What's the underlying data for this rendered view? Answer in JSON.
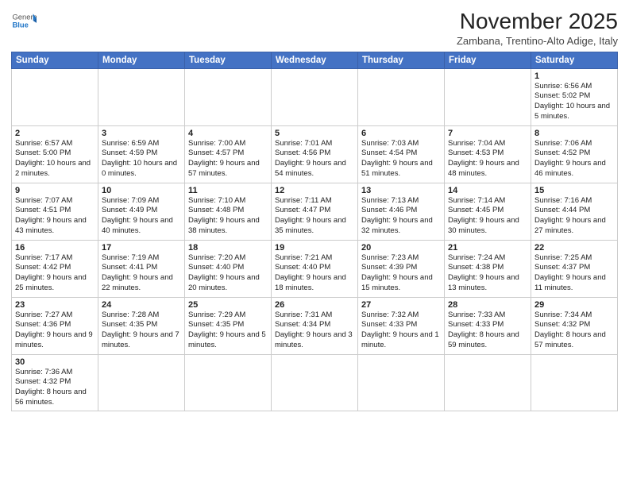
{
  "header": {
    "logo_general": "General",
    "logo_blue": "Blue",
    "title": "November 2025",
    "subtitle": "Zambana, Trentino-Alto Adige, Italy"
  },
  "days": [
    "Sunday",
    "Monday",
    "Tuesday",
    "Wednesday",
    "Thursday",
    "Friday",
    "Saturday"
  ],
  "weeks": [
    [
      {
        "date": "",
        "info": ""
      },
      {
        "date": "",
        "info": ""
      },
      {
        "date": "",
        "info": ""
      },
      {
        "date": "",
        "info": ""
      },
      {
        "date": "",
        "info": ""
      },
      {
        "date": "",
        "info": ""
      },
      {
        "date": "1",
        "info": "Sunrise: 6:56 AM\nSunset: 5:02 PM\nDaylight: 10 hours and 5 minutes."
      }
    ],
    [
      {
        "date": "2",
        "info": "Sunrise: 6:57 AM\nSunset: 5:00 PM\nDaylight: 10 hours and 2 minutes."
      },
      {
        "date": "3",
        "info": "Sunrise: 6:59 AM\nSunset: 4:59 PM\nDaylight: 10 hours and 0 minutes."
      },
      {
        "date": "4",
        "info": "Sunrise: 7:00 AM\nSunset: 4:57 PM\nDaylight: 9 hours and 57 minutes."
      },
      {
        "date": "5",
        "info": "Sunrise: 7:01 AM\nSunset: 4:56 PM\nDaylight: 9 hours and 54 minutes."
      },
      {
        "date": "6",
        "info": "Sunrise: 7:03 AM\nSunset: 4:54 PM\nDaylight: 9 hours and 51 minutes."
      },
      {
        "date": "7",
        "info": "Sunrise: 7:04 AM\nSunset: 4:53 PM\nDaylight: 9 hours and 48 minutes."
      },
      {
        "date": "8",
        "info": "Sunrise: 7:06 AM\nSunset: 4:52 PM\nDaylight: 9 hours and 46 minutes."
      }
    ],
    [
      {
        "date": "9",
        "info": "Sunrise: 7:07 AM\nSunset: 4:51 PM\nDaylight: 9 hours and 43 minutes."
      },
      {
        "date": "10",
        "info": "Sunrise: 7:09 AM\nSunset: 4:49 PM\nDaylight: 9 hours and 40 minutes."
      },
      {
        "date": "11",
        "info": "Sunrise: 7:10 AM\nSunset: 4:48 PM\nDaylight: 9 hours and 38 minutes."
      },
      {
        "date": "12",
        "info": "Sunrise: 7:11 AM\nSunset: 4:47 PM\nDaylight: 9 hours and 35 minutes."
      },
      {
        "date": "13",
        "info": "Sunrise: 7:13 AM\nSunset: 4:46 PM\nDaylight: 9 hours and 32 minutes."
      },
      {
        "date": "14",
        "info": "Sunrise: 7:14 AM\nSunset: 4:45 PM\nDaylight: 9 hours and 30 minutes."
      },
      {
        "date": "15",
        "info": "Sunrise: 7:16 AM\nSunset: 4:44 PM\nDaylight: 9 hours and 27 minutes."
      }
    ],
    [
      {
        "date": "16",
        "info": "Sunrise: 7:17 AM\nSunset: 4:42 PM\nDaylight: 9 hours and 25 minutes."
      },
      {
        "date": "17",
        "info": "Sunrise: 7:19 AM\nSunset: 4:41 PM\nDaylight: 9 hours and 22 minutes."
      },
      {
        "date": "18",
        "info": "Sunrise: 7:20 AM\nSunset: 4:40 PM\nDaylight: 9 hours and 20 minutes."
      },
      {
        "date": "19",
        "info": "Sunrise: 7:21 AM\nSunset: 4:40 PM\nDaylight: 9 hours and 18 minutes."
      },
      {
        "date": "20",
        "info": "Sunrise: 7:23 AM\nSunset: 4:39 PM\nDaylight: 9 hours and 15 minutes."
      },
      {
        "date": "21",
        "info": "Sunrise: 7:24 AM\nSunset: 4:38 PM\nDaylight: 9 hours and 13 minutes."
      },
      {
        "date": "22",
        "info": "Sunrise: 7:25 AM\nSunset: 4:37 PM\nDaylight: 9 hours and 11 minutes."
      }
    ],
    [
      {
        "date": "23",
        "info": "Sunrise: 7:27 AM\nSunset: 4:36 PM\nDaylight: 9 hours and 9 minutes."
      },
      {
        "date": "24",
        "info": "Sunrise: 7:28 AM\nSunset: 4:35 PM\nDaylight: 9 hours and 7 minutes."
      },
      {
        "date": "25",
        "info": "Sunrise: 7:29 AM\nSunset: 4:35 PM\nDaylight: 9 hours and 5 minutes."
      },
      {
        "date": "26",
        "info": "Sunrise: 7:31 AM\nSunset: 4:34 PM\nDaylight: 9 hours and 3 minutes."
      },
      {
        "date": "27",
        "info": "Sunrise: 7:32 AM\nSunset: 4:33 PM\nDaylight: 9 hours and 1 minute."
      },
      {
        "date": "28",
        "info": "Sunrise: 7:33 AM\nSunset: 4:33 PM\nDaylight: 8 hours and 59 minutes."
      },
      {
        "date": "29",
        "info": "Sunrise: 7:34 AM\nSunset: 4:32 PM\nDaylight: 8 hours and 57 minutes."
      }
    ],
    [
      {
        "date": "30",
        "info": "Sunrise: 7:36 AM\nSunset: 4:32 PM\nDaylight: 8 hours and 56 minutes."
      },
      {
        "date": "",
        "info": ""
      },
      {
        "date": "",
        "info": ""
      },
      {
        "date": "",
        "info": ""
      },
      {
        "date": "",
        "info": ""
      },
      {
        "date": "",
        "info": ""
      },
      {
        "date": "",
        "info": ""
      }
    ]
  ]
}
